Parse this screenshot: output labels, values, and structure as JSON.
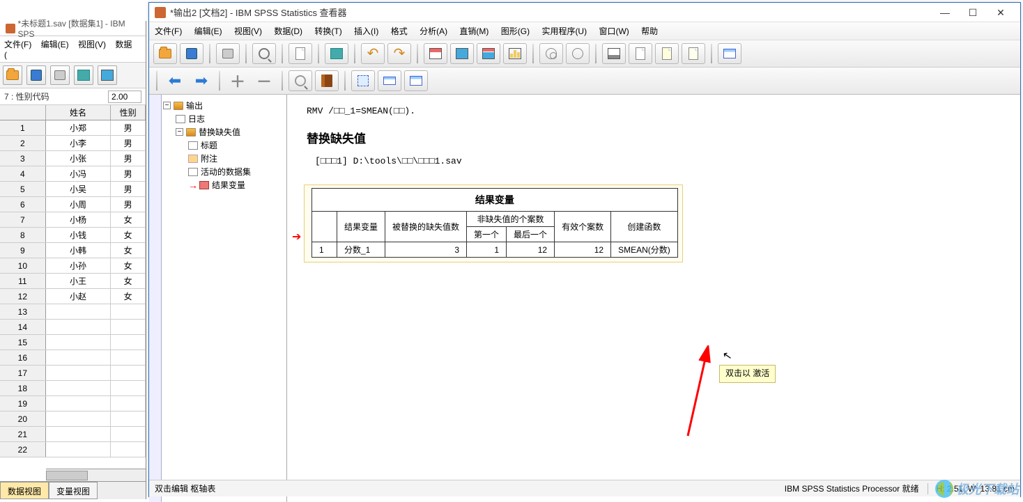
{
  "bg_window": {
    "title": "*未标题1.sav [数据集1] - IBM SPS",
    "menus": [
      "文件(F)",
      "编辑(E)",
      "视图(V)",
      "数据("
    ],
    "label_row": {
      "label": "7 : 性别代码",
      "value": "2.00"
    },
    "headers": [
      "",
      "姓名",
      "性别"
    ],
    "rows": [
      {
        "n": "1",
        "name": "小郑",
        "sex": "男"
      },
      {
        "n": "2",
        "name": "小李",
        "sex": "男"
      },
      {
        "n": "3",
        "name": "小张",
        "sex": "男"
      },
      {
        "n": "4",
        "name": "小冯",
        "sex": "男"
      },
      {
        "n": "5",
        "name": "小吴",
        "sex": "男"
      },
      {
        "n": "6",
        "name": "小周",
        "sex": "男"
      },
      {
        "n": "7",
        "name": "小杨",
        "sex": "女"
      },
      {
        "n": "8",
        "name": "小钱",
        "sex": "女"
      },
      {
        "n": "9",
        "name": "小韩",
        "sex": "女"
      },
      {
        "n": "10",
        "name": "小孙",
        "sex": "女"
      },
      {
        "n": "11",
        "name": "小王",
        "sex": "女"
      },
      {
        "n": "12",
        "name": "小赵",
        "sex": "女"
      },
      {
        "n": "13",
        "name": "",
        "sex": ""
      },
      {
        "n": "14",
        "name": "",
        "sex": ""
      },
      {
        "n": "15",
        "name": "",
        "sex": ""
      },
      {
        "n": "16",
        "name": "",
        "sex": ""
      },
      {
        "n": "17",
        "name": "",
        "sex": ""
      },
      {
        "n": "18",
        "name": "",
        "sex": ""
      },
      {
        "n": "19",
        "name": "",
        "sex": ""
      },
      {
        "n": "20",
        "name": "",
        "sex": ""
      },
      {
        "n": "21",
        "name": "",
        "sex": ""
      },
      {
        "n": "22",
        "name": "",
        "sex": ""
      }
    ],
    "tabs": {
      "data_view": "数据视图",
      "variable_view": "变量视图"
    }
  },
  "viewer": {
    "title": "*输出2 [文档2] - IBM SPSS Statistics 查看器",
    "menus": [
      "文件(F)",
      "编辑(E)",
      "视图(V)",
      "数据(D)",
      "转换(T)",
      "插入(I)",
      "格式",
      "分析(A)",
      "直销(M)",
      "图形(G)",
      "实用程序(U)",
      "窗口(W)",
      "帮助"
    ],
    "tree": {
      "root": "输出",
      "l1a": "日志",
      "l1b": "替换缺失值",
      "l2a": "标题",
      "l2b": "附注",
      "l2c": "活动的数据集",
      "l2d": "结果变量"
    },
    "cmd": "RMV  /□□_1=SMEAN(□□).",
    "section_title": "替换缺失值",
    "path_text": "[□□□1] D:\\tools\\□□\\□□□1.sav",
    "pivot": {
      "caption": "结果变量",
      "h_result_var": "结果变量",
      "h_replaced": "被替换的缺失值数",
      "h_nonmiss": "非缺失值的个案数",
      "h_first": "第一个",
      "h_last": "最后一个",
      "h_valid": "有效个案数",
      "h_createfn": "创建函数",
      "r_idx": "1",
      "r_var": "分数_1",
      "r_replaced": "3",
      "r_first": "1",
      "r_last": "12",
      "r_valid": "12",
      "r_fn": "SMEAN(分数)"
    },
    "tooltip": "双击以\n激活",
    "status": {
      "left": "双击编辑  枢轴表",
      "processor": "IBM SPSS Statistics Processor 就绪",
      "measure": "H: 2.51, W: 13.81 cm"
    }
  },
  "watermark": "极光下载站"
}
